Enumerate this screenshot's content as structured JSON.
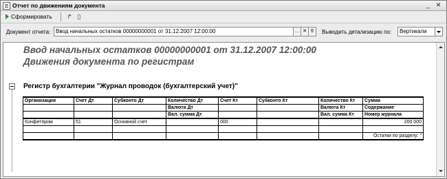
{
  "window": {
    "title": "Отчет по движениям документа"
  },
  "toolbar": {
    "generate_label": "Сформировать"
  },
  "params": {
    "document_label": "Документ отчета:",
    "document_value": "Ввод начальных остатков 00000000001 от 31.12.2007 12:00:00",
    "detail_label": "Выводить детализацию по:",
    "detail_value": "Вертикали"
  },
  "report": {
    "title": "Ввод начальных остатков 00000000001 от 31.12.2007 12:00:00",
    "subtitle": "Движения документа по регистрам",
    "register_title": "Регистр бухгалтерии \"Журнал проводок (бухгалтерский учет)\"",
    "headers": {
      "org": "Организация",
      "acc_dt": "Счет Дт",
      "sub_dt": "Субконто Дт",
      "qty_dt": "Количество Дт",
      "cur_dt": "Валюта Дт",
      "cursum_dt": "Вал. сумма Дт",
      "acc_kt": "Счет Кт",
      "sub_kt": "Субконто Кт",
      "qty_kt": "Количество Кт",
      "cur_kt": "Валюта Кт",
      "cursum_kt": "Вал. сумма Кт",
      "sum": "Сумма",
      "content": "Содержание",
      "journal": "Номер журнала"
    },
    "row": {
      "org": "Конфетпром",
      "acc_dt": "51",
      "sub_dt": "Основной счет",
      "acc_kt": "000",
      "sum": "200 000",
      "section_total": "Остатки по разделу: \""
    }
  }
}
